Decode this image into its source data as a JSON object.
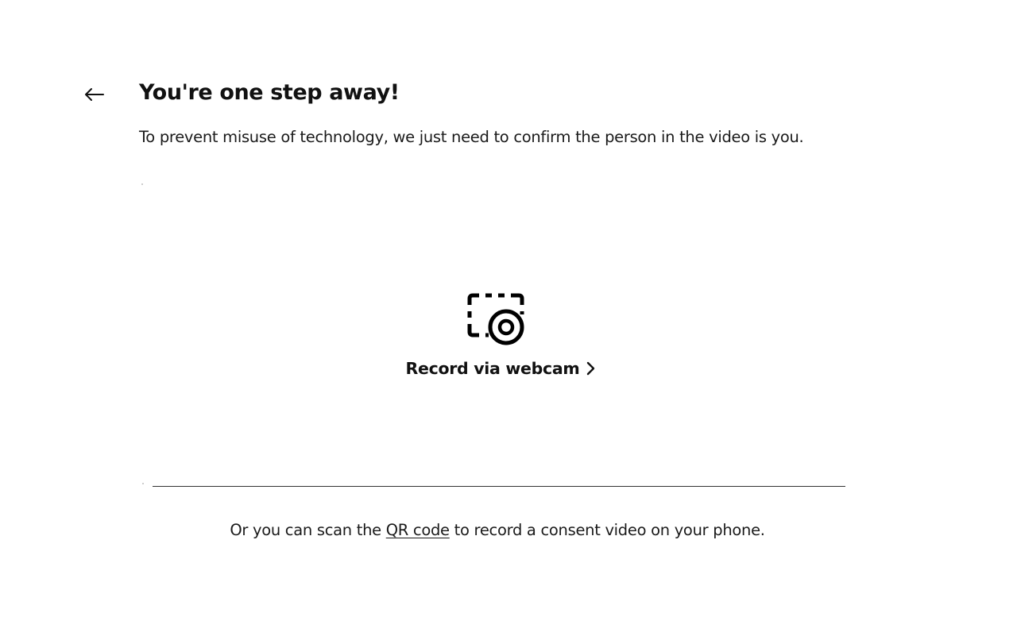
{
  "header": {
    "back_icon": "arrow-left-icon",
    "title": "You're one step away!",
    "subtitle": "To prevent misuse of technology, we just need to confirm the person in the video is you."
  },
  "webcam_option": {
    "icon": "webcam-record-icon",
    "label": "Record via webcam",
    "chevron_icon": "chevron-right-icon"
  },
  "footer": {
    "text_before": "Or you can scan the ",
    "qr_link": "QR code",
    "text_after": " to record a consent video on your phone."
  }
}
